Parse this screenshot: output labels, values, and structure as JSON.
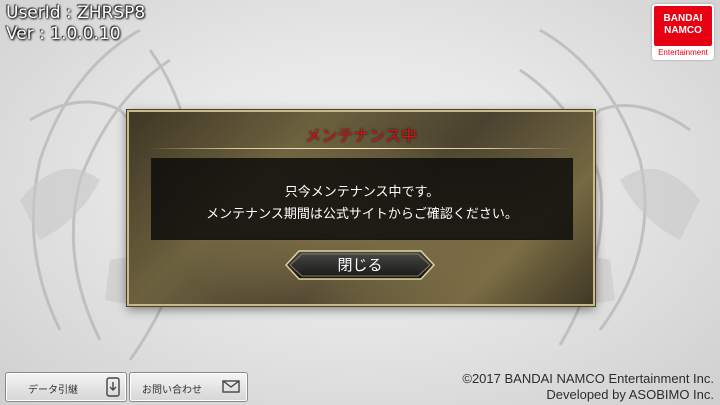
{
  "user": {
    "user_id": "UserId : ZHRSP8",
    "version": "Ver : 1.0.0.10"
  },
  "logo": {
    "line1": "BANDAI",
    "line2": "NAMCO",
    "sub": "Entertainment"
  },
  "dialog": {
    "title": "メンテナンス中",
    "message_line1": "只今メンテナンス中です。",
    "message_line2": "メンテナンス期間は公式サイトからご確認ください。",
    "close_label": "閉じる"
  },
  "footer": {
    "data_transfer_label": "データ引継",
    "contact_label": "お問い合わせ",
    "copyright_line1": "©2017 BANDAI NAMCO Entertainment Inc.",
    "copyright_line2": "Developed by ASOBIMO Inc."
  },
  "colors": {
    "dialog_title": "#e01010",
    "brand_red": "#e60012",
    "dialog_border": "#c9b98a"
  },
  "icons": {
    "background": "phoenix-emblem",
    "data_transfer": "phone-transfer-icon",
    "contact": "mail-icon"
  }
}
